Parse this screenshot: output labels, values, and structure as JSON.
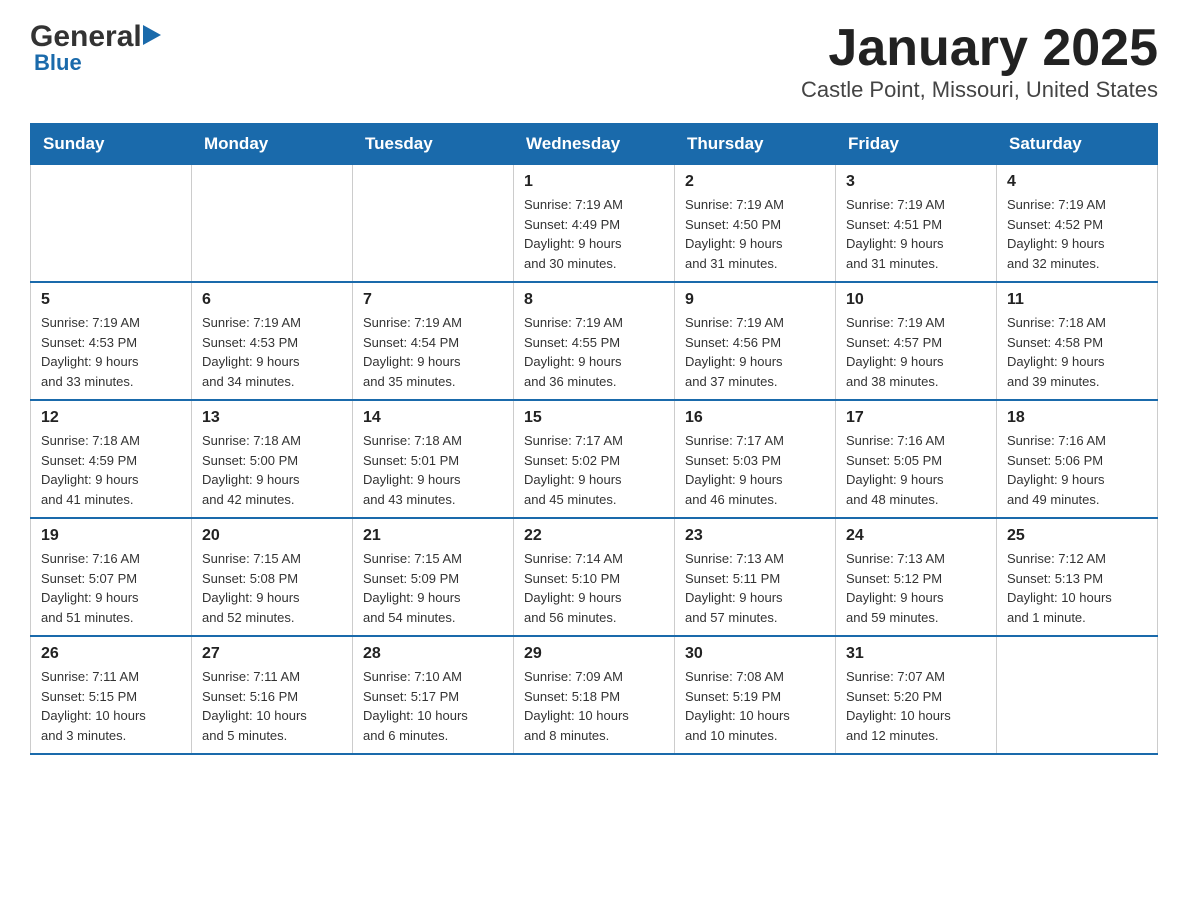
{
  "header": {
    "logo_general": "General",
    "logo_blue": "Blue",
    "title": "January 2025",
    "subtitle": "Castle Point, Missouri, United States"
  },
  "calendar": {
    "days_of_week": [
      "Sunday",
      "Monday",
      "Tuesday",
      "Wednesday",
      "Thursday",
      "Friday",
      "Saturday"
    ],
    "weeks": [
      [
        {
          "day": "",
          "info": ""
        },
        {
          "day": "",
          "info": ""
        },
        {
          "day": "",
          "info": ""
        },
        {
          "day": "1",
          "info": "Sunrise: 7:19 AM\nSunset: 4:49 PM\nDaylight: 9 hours\nand 30 minutes."
        },
        {
          "day": "2",
          "info": "Sunrise: 7:19 AM\nSunset: 4:50 PM\nDaylight: 9 hours\nand 31 minutes."
        },
        {
          "day": "3",
          "info": "Sunrise: 7:19 AM\nSunset: 4:51 PM\nDaylight: 9 hours\nand 31 minutes."
        },
        {
          "day": "4",
          "info": "Sunrise: 7:19 AM\nSunset: 4:52 PM\nDaylight: 9 hours\nand 32 minutes."
        }
      ],
      [
        {
          "day": "5",
          "info": "Sunrise: 7:19 AM\nSunset: 4:53 PM\nDaylight: 9 hours\nand 33 minutes."
        },
        {
          "day": "6",
          "info": "Sunrise: 7:19 AM\nSunset: 4:53 PM\nDaylight: 9 hours\nand 34 minutes."
        },
        {
          "day": "7",
          "info": "Sunrise: 7:19 AM\nSunset: 4:54 PM\nDaylight: 9 hours\nand 35 minutes."
        },
        {
          "day": "8",
          "info": "Sunrise: 7:19 AM\nSunset: 4:55 PM\nDaylight: 9 hours\nand 36 minutes."
        },
        {
          "day": "9",
          "info": "Sunrise: 7:19 AM\nSunset: 4:56 PM\nDaylight: 9 hours\nand 37 minutes."
        },
        {
          "day": "10",
          "info": "Sunrise: 7:19 AM\nSunset: 4:57 PM\nDaylight: 9 hours\nand 38 minutes."
        },
        {
          "day": "11",
          "info": "Sunrise: 7:18 AM\nSunset: 4:58 PM\nDaylight: 9 hours\nand 39 minutes."
        }
      ],
      [
        {
          "day": "12",
          "info": "Sunrise: 7:18 AM\nSunset: 4:59 PM\nDaylight: 9 hours\nand 41 minutes."
        },
        {
          "day": "13",
          "info": "Sunrise: 7:18 AM\nSunset: 5:00 PM\nDaylight: 9 hours\nand 42 minutes."
        },
        {
          "day": "14",
          "info": "Sunrise: 7:18 AM\nSunset: 5:01 PM\nDaylight: 9 hours\nand 43 minutes."
        },
        {
          "day": "15",
          "info": "Sunrise: 7:17 AM\nSunset: 5:02 PM\nDaylight: 9 hours\nand 45 minutes."
        },
        {
          "day": "16",
          "info": "Sunrise: 7:17 AM\nSunset: 5:03 PM\nDaylight: 9 hours\nand 46 minutes."
        },
        {
          "day": "17",
          "info": "Sunrise: 7:16 AM\nSunset: 5:05 PM\nDaylight: 9 hours\nand 48 minutes."
        },
        {
          "day": "18",
          "info": "Sunrise: 7:16 AM\nSunset: 5:06 PM\nDaylight: 9 hours\nand 49 minutes."
        }
      ],
      [
        {
          "day": "19",
          "info": "Sunrise: 7:16 AM\nSunset: 5:07 PM\nDaylight: 9 hours\nand 51 minutes."
        },
        {
          "day": "20",
          "info": "Sunrise: 7:15 AM\nSunset: 5:08 PM\nDaylight: 9 hours\nand 52 minutes."
        },
        {
          "day": "21",
          "info": "Sunrise: 7:15 AM\nSunset: 5:09 PM\nDaylight: 9 hours\nand 54 minutes."
        },
        {
          "day": "22",
          "info": "Sunrise: 7:14 AM\nSunset: 5:10 PM\nDaylight: 9 hours\nand 56 minutes."
        },
        {
          "day": "23",
          "info": "Sunrise: 7:13 AM\nSunset: 5:11 PM\nDaylight: 9 hours\nand 57 minutes."
        },
        {
          "day": "24",
          "info": "Sunrise: 7:13 AM\nSunset: 5:12 PM\nDaylight: 9 hours\nand 59 minutes."
        },
        {
          "day": "25",
          "info": "Sunrise: 7:12 AM\nSunset: 5:13 PM\nDaylight: 10 hours\nand 1 minute."
        }
      ],
      [
        {
          "day": "26",
          "info": "Sunrise: 7:11 AM\nSunset: 5:15 PM\nDaylight: 10 hours\nand 3 minutes."
        },
        {
          "day": "27",
          "info": "Sunrise: 7:11 AM\nSunset: 5:16 PM\nDaylight: 10 hours\nand 5 minutes."
        },
        {
          "day": "28",
          "info": "Sunrise: 7:10 AM\nSunset: 5:17 PM\nDaylight: 10 hours\nand 6 minutes."
        },
        {
          "day": "29",
          "info": "Sunrise: 7:09 AM\nSunset: 5:18 PM\nDaylight: 10 hours\nand 8 minutes."
        },
        {
          "day": "30",
          "info": "Sunrise: 7:08 AM\nSunset: 5:19 PM\nDaylight: 10 hours\nand 10 minutes."
        },
        {
          "day": "31",
          "info": "Sunrise: 7:07 AM\nSunset: 5:20 PM\nDaylight: 10 hours\nand 12 minutes."
        },
        {
          "day": "",
          "info": ""
        }
      ]
    ]
  }
}
